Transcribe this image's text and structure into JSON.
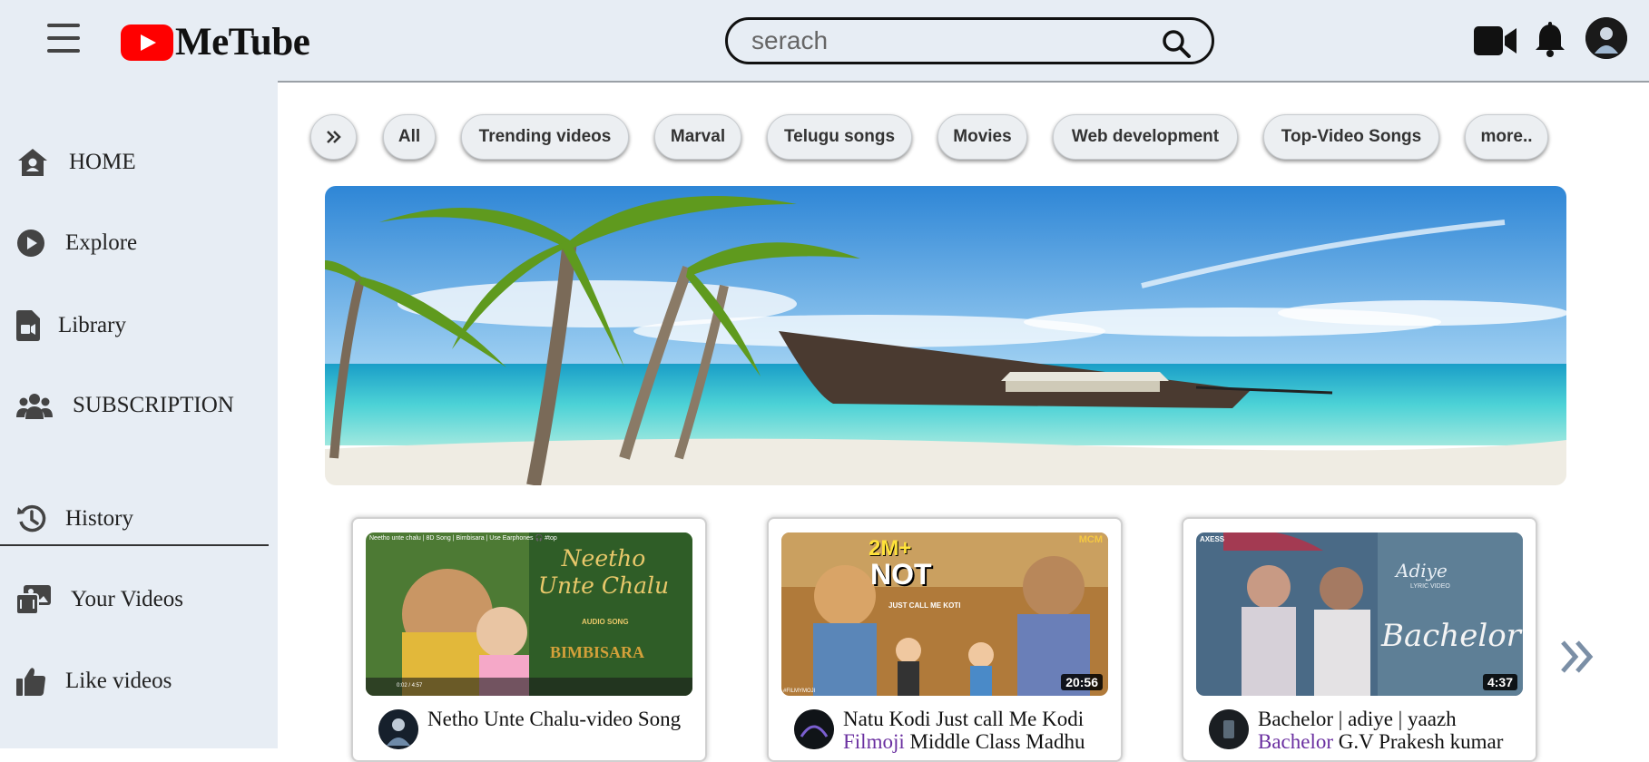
{
  "header": {
    "logo_text": "MeTube",
    "search_placeholder": "serach",
    "icons": [
      "menu-icon",
      "youtube-logo-icon",
      "search-icon",
      "video-camera-icon",
      "bell-icon",
      "avatar"
    ]
  },
  "sidebar": {
    "items": [
      {
        "label": "HOME",
        "icon": "home-icon"
      },
      {
        "label": "Explore",
        "icon": "play-circle-icon"
      },
      {
        "label": "Library",
        "icon": "file-video-icon"
      },
      {
        "label": "SUBSCRIPTION",
        "icon": "users-icon"
      },
      {
        "label": "History",
        "icon": "history-icon"
      },
      {
        "label": "Your Videos",
        "icon": "photo-video-icon"
      },
      {
        "label": "Like videos",
        "icon": "thumbs-up-icon"
      }
    ]
  },
  "chips": [
    "All",
    "Trending videos",
    "Marval",
    "Telugu songs",
    "Movies",
    "Web development",
    "Top-Video Songs",
    "more.."
  ],
  "videos": [
    {
      "title": "Netho Unte Chalu-video Song",
      "thumb_title": "Neetho Unte Chalu",
      "thumb_sub": "BIMBISARA",
      "thumb_tag": "AUDIO SONG",
      "thumb_caption": "Neetho unte chalu | 8D Song | Bimbisara | Use Earphones 🎧 #top",
      "player_time": "0:02 / 4:57",
      "duration": ""
    },
    {
      "title_plain": "Natu Kodi Just call Me Kodi ",
      "title_hl": "Filmoji",
      "title_rest": " Middle Class Madhu",
      "thumb_views": "2M+",
      "thumb_title": "NOT",
      "thumb_sub": "JUST CALL ME KOTI",
      "thumb_brand": "MCM",
      "thumb_brand2": "#FILMYMOJI",
      "duration": "20:56"
    },
    {
      "title_plain": "Bachelor | adiye | yaazh ",
      "title_hl": "Bachelor",
      "title_rest": " G.V Prakesh kumar",
      "thumb_title": "Bachelor",
      "thumb_sub": "Adiye",
      "thumb_tag": "LYRIC VIDEO",
      "thumb_brand": "AXESS",
      "duration": "4:37"
    }
  ],
  "colors": {
    "header_bg": "#e7edf4",
    "sidebar_bg": "#e7edf4",
    "logo_red": "#ff0000",
    "link_purple": "#6a2fa0"
  }
}
